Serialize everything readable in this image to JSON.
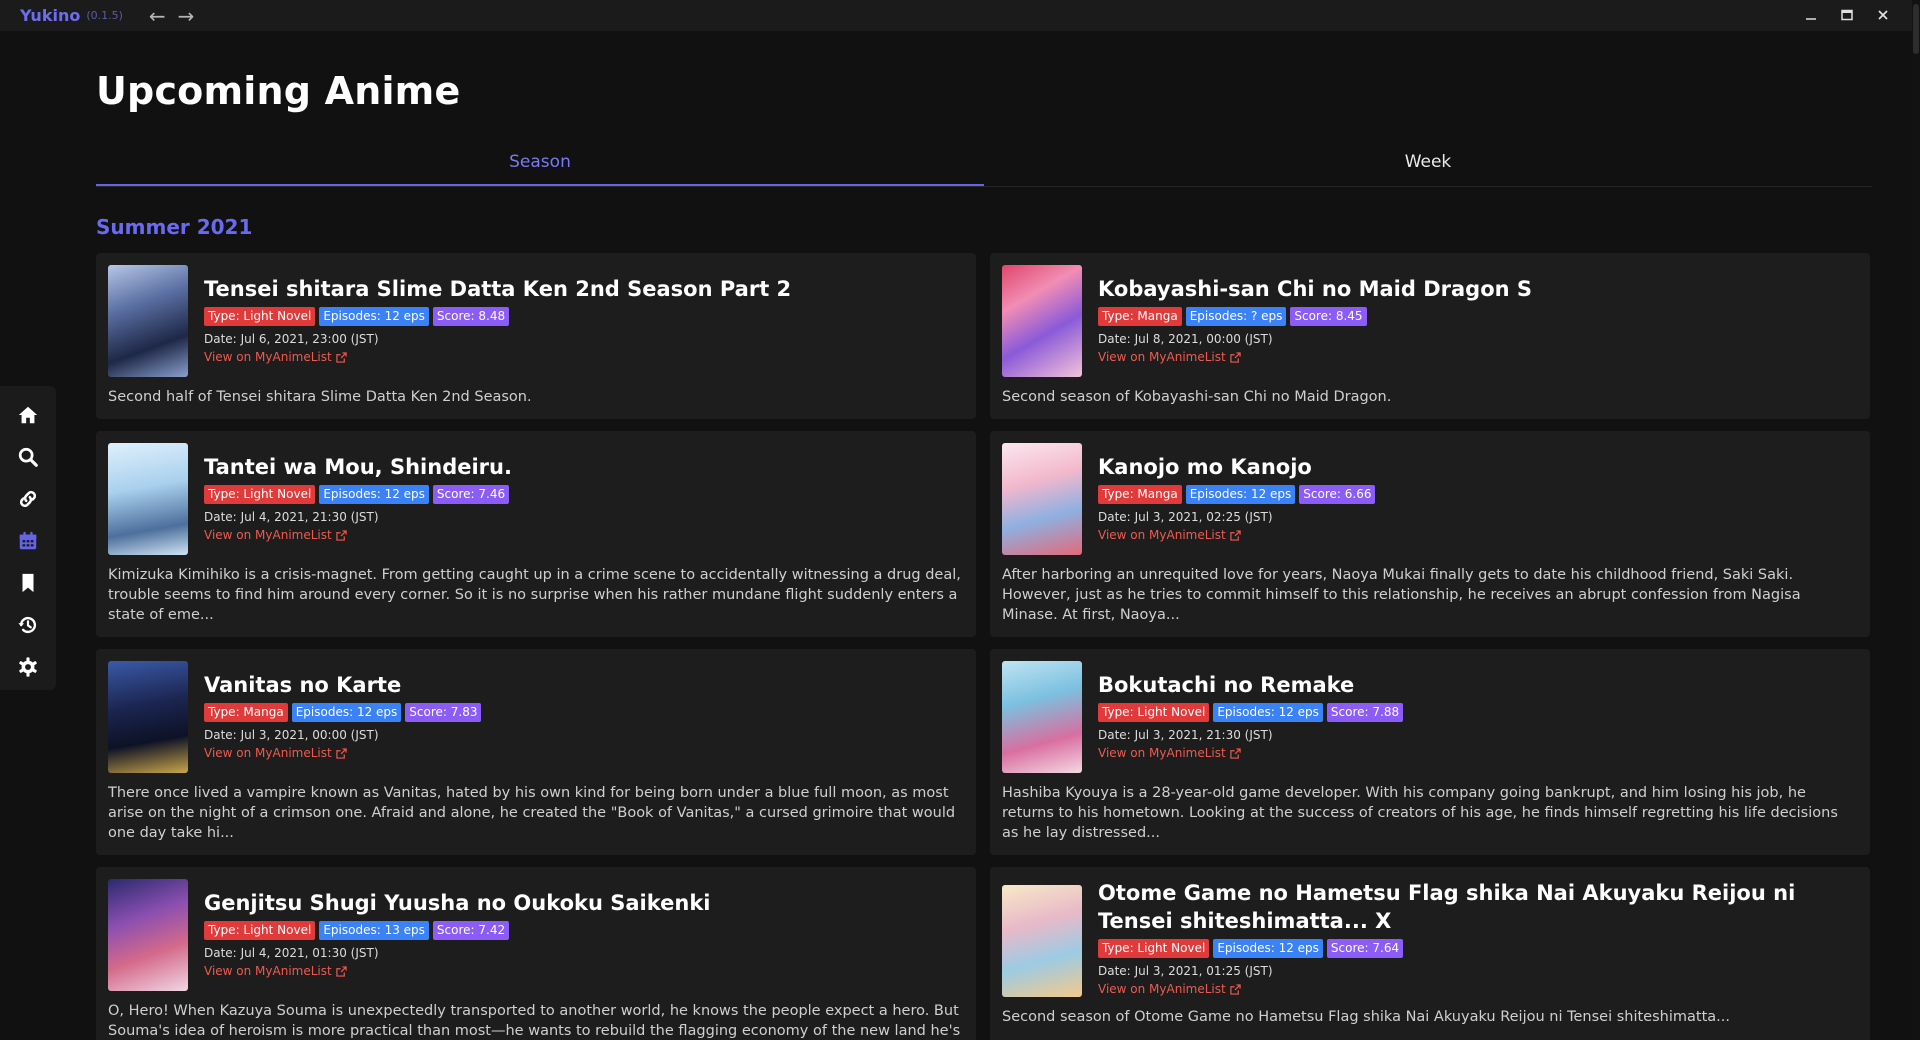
{
  "app": {
    "name": "Yukino",
    "version": "(0.1.5)"
  },
  "titlebar": {
    "back": "←",
    "forward": "→",
    "minimize": "_",
    "maximize": "▭",
    "close": "✕"
  },
  "sidebar": {
    "items": [
      "home-icon",
      "search-icon",
      "link-icon",
      "calendar-icon",
      "bookmark-icon",
      "history-icon",
      "gear-icon"
    ],
    "active": "calendar-icon",
    "accent": "#6464e6"
  },
  "page": {
    "title": "Upcoming Anime"
  },
  "tabs": [
    {
      "label": "Season",
      "active": true
    },
    {
      "label": "Week",
      "active": false
    }
  ],
  "season": {
    "title": "Summer 2021"
  },
  "colors": {
    "accent": "#6464e6",
    "type_badge": "#e03a3a",
    "episodes_badge": "#3b82f6",
    "score_badge": "#8b5cf6",
    "link": "#ee5a4f"
  },
  "link_label": "View on MyAnimeList",
  "anime": [
    {
      "title": "Tensei shitara Slime Datta Ken 2nd Season Part 2",
      "type": "Type: Light Novel",
      "episodes": "Episodes: 12 eps",
      "score": "Score: 8.48",
      "date_label": "Date:",
      "date": "Jul 6, 2021, 23:00 (JST)",
      "description": "Second half of Tensei shitara Slime Datta Ken 2nd Season."
    },
    {
      "title": "Kobayashi-san Chi no Maid Dragon S",
      "type": "Type: Manga",
      "episodes": "Episodes: ? eps",
      "score": "Score: 8.45",
      "date_label": "Date:",
      "date": "Jul 8, 2021, 00:00 (JST)",
      "description": "Second season of Kobayashi-san Chi no Maid Dragon."
    },
    {
      "title": "Tantei wa Mou, Shindeiru.",
      "type": "Type: Light Novel",
      "episodes": "Episodes: 12 eps",
      "score": "Score: 7.46",
      "date_label": "Date:",
      "date": "Jul 4, 2021, 21:30 (JST)",
      "description": "Kimizuka Kimihiko is a crisis-magnet. From getting caught up in a crime scene to accidentally witnessing a drug deal, trouble seems to find him around every corner. So it is no surprise when his rather mundane flight suddenly enters a state of eme..."
    },
    {
      "title": "Kanojo mo Kanojo",
      "type": "Type: Manga",
      "episodes": "Episodes: 12 eps",
      "score": "Score: 6.66",
      "date_label": "Date:",
      "date": "Jul 3, 2021, 02:25 (JST)",
      "description": "After harboring an unrequited love for years, Naoya Mukai finally gets to date his childhood friend, Saki Saki. However, just as he tries to commit himself to this relationship, he receives an abrupt confession from Nagisa Minase. At first, Naoya..."
    },
    {
      "title": "Vanitas no Karte",
      "type": "Type: Manga",
      "episodes": "Episodes: 12 eps",
      "score": "Score: 7.83",
      "date_label": "Date:",
      "date": "Jul 3, 2021, 00:00 (JST)",
      "description": "There once lived a vampire known as Vanitas, hated by his own kind for being born under a blue full moon, as most arise on the night of a crimson one. Afraid and alone, he created the \"Book of Vanitas,\" a cursed grimoire that would one day take hi..."
    },
    {
      "title": "Bokutachi no Remake",
      "type": "Type: Light Novel",
      "episodes": "Episodes: 12 eps",
      "score": "Score: 7.88",
      "date_label": "Date:",
      "date": "Jul 3, 2021, 21:30 (JST)",
      "description": "Hashiba Kyouya is a 28-year-old game developer. With his company going bankrupt, and him losing his job, he returns to his hometown. Looking at the success of creators of his age, he finds himself regretting his life decisions as he lay distressed..."
    },
    {
      "title": "Genjitsu Shugi Yuusha no Oukoku Saikenki",
      "type": "Type: Light Novel",
      "episodes": "Episodes: 13 eps",
      "score": "Score: 7.42",
      "date_label": "Date:",
      "date": "Jul 4, 2021, 01:30 (JST)",
      "description": "O, Hero! When Kazuya Souma is unexpectedly transported to another world, he knows the people expect a hero. But Souma's idea of heroism is more practical than most—he wants to rebuild the flagging economy of the new land he's found himself in! Be..."
    },
    {
      "title": "Otome Game no Hametsu Flag shika Nai Akuyaku Reijou ni Tensei shiteshimatta... X",
      "type": "Type: Light Novel",
      "episodes": "Episodes: 12 eps",
      "score": "Score: 7.64",
      "date_label": "Date:",
      "date": "Jul 3, 2021, 01:25 (JST)",
      "description": "Second season of Otome Game no Hametsu Flag shika Nai Akuyaku Reijou ni Tensei shiteshimatta..."
    }
  ]
}
